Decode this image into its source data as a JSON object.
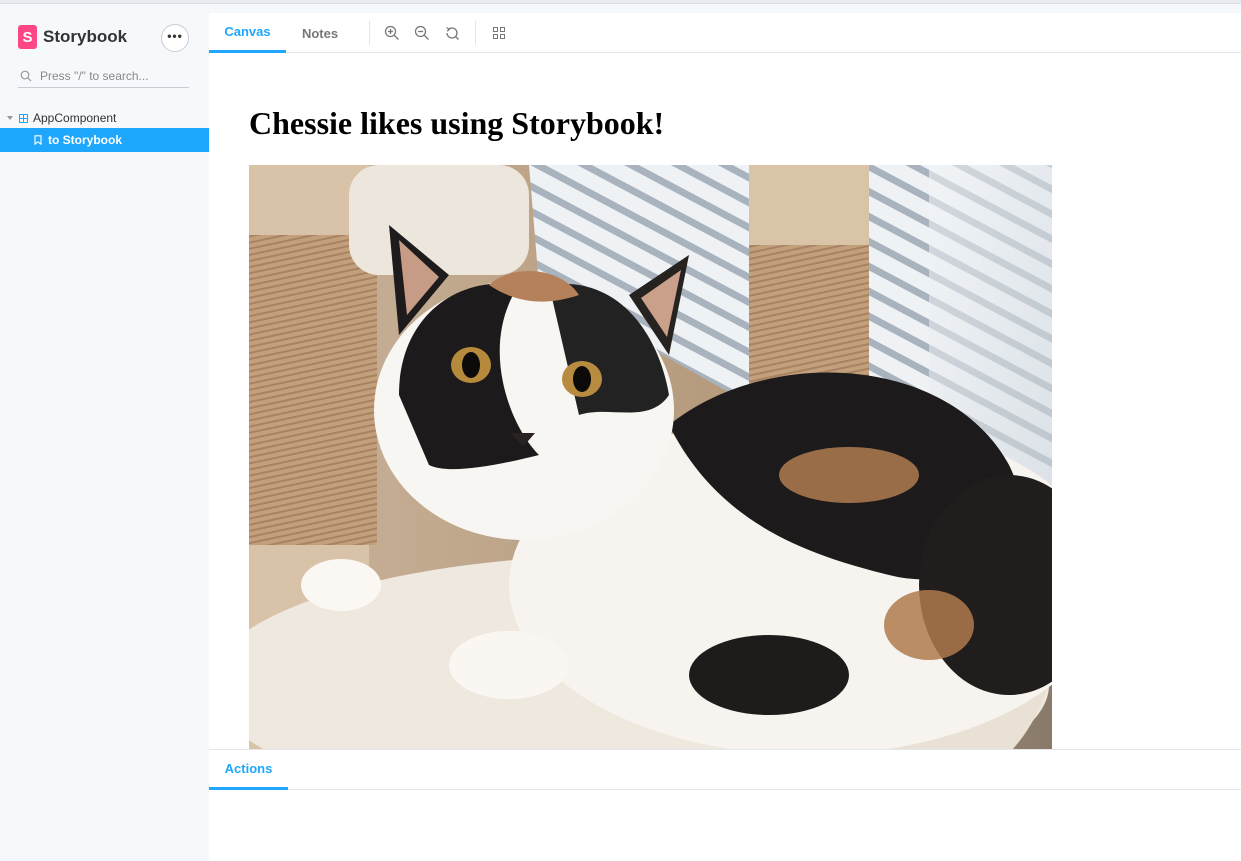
{
  "sidebar": {
    "brand": {
      "logo_letter": "S",
      "name": "Storybook",
      "logo_color": "#ff4785"
    },
    "menu_button": {
      "label": "•••",
      "icon": "ellipsis-icon"
    },
    "search": {
      "placeholder": "Press \"/\" to search...",
      "value": ""
    },
    "tree": {
      "component": {
        "label": "AppComponent",
        "icon": "component-icon"
      },
      "story": {
        "label": "to Storybook",
        "icon": "bookmark-icon",
        "selected": true
      }
    }
  },
  "toolbar": {
    "tabs": [
      {
        "label": "Canvas",
        "active": true
      },
      {
        "label": "Notes",
        "active": false
      }
    ],
    "tools": [
      "zoom-in-icon",
      "zoom-out-icon",
      "reset-zoom-icon",
      "grid-icon"
    ]
  },
  "canvas": {
    "headline": "Chessie likes using Storybook!",
    "image": {
      "subject": "calico-cat-photo"
    }
  },
  "addons": {
    "tabs": [
      {
        "label": "Actions",
        "active": true
      }
    ]
  },
  "colors": {
    "accent": "#1ea7fd",
    "sidebar_bg": "#f6f9fc",
    "brand": "#ff4785"
  }
}
